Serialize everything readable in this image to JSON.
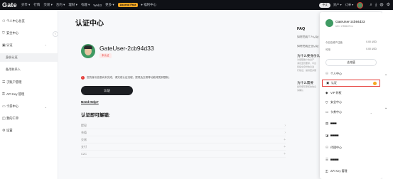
{
  "topbar": {
    "logo": "Gate",
    "nav": [
      "买币 ▾",
      "行情",
      "交易 ▾",
      "合约 ▾",
      "理财 ▾",
      "有趣 ▾",
      "Web3",
      "更多 ▾"
    ],
    "promo": "Ascend Fast",
    "promo_extra": "● 福利中心",
    "lang": "中文",
    "assets": "资产 ▾",
    "orders": "订单 ▾"
  },
  "sidebar": {
    "items": [
      {
        "icon": "person-icon",
        "label": "个人中心总览"
      },
      {
        "icon": "shield-icon",
        "label": "安全中心"
      },
      {
        "icon": "id-icon",
        "label": "认证",
        "expanded": true
      },
      {
        "icon": "",
        "label": "身份认证",
        "sub": true,
        "active": true
      },
      {
        "icon": "",
        "label": "备用联系人",
        "sub": true
      },
      {
        "icon": "list-icon",
        "label": "子账户管理"
      },
      {
        "icon": "key-icon",
        "label": "API Key 管理"
      },
      {
        "icon": "card-icon",
        "label": "卡券中心"
      },
      {
        "icon": "wallet-icon",
        "label": "我的工单"
      },
      {
        "icon": "gear-icon",
        "label": "设置"
      }
    ]
  },
  "main": {
    "title": "认证中心",
    "username": "GateUser-2cb94d33",
    "status_badge": "未认证",
    "warning": "您的身份信息尚未完成，请完成认证流程，提现及交易等功能将受到限制。",
    "verify_button": "认证",
    "need_help": "Need Help?",
    "permissions_title": "认证即可解锁:",
    "permissions": [
      "提现",
      "充值",
      "交易",
      "支付",
      "C2C"
    ]
  },
  "faq": {
    "title": "FAQ",
    "q1": "如何完成个人认证",
    "q2": "如何完成企业认证",
    "h1": "为什么要身份认证",
    "p1": [
      "为保障账户的资产",
      "满足监管要求，平台",
      "您提交身份信息进",
      "行验证，提供更多服"
    ],
    "h2": "为什么需要",
    "p2": [
      "如何填写审核的信息",
      "请确认"
    ]
  },
  "dropdown": {
    "name": "GateUser-2cb94d33",
    "uid": "UID: 17856478 ⧉",
    "line1_label": "今日总资产估值",
    "line1_value": "0.00 USD",
    "line2_label": "可用",
    "line2_value": "0.00 USD",
    "deposit_button": "去充值",
    "items": [
      {
        "icon": "person-icon",
        "label": "个人中心"
      },
      {
        "icon": "id-icon",
        "label": "认证",
        "highlight": true
      },
      {
        "icon": "vip-icon",
        "label": "VIP 特权"
      },
      {
        "icon": "shield-icon",
        "label": "安全中心"
      },
      {
        "icon": "card-icon",
        "label": "卡券中心"
      },
      {
        "icon": "gift-icon",
        "label": "▀▀▀"
      },
      {
        "icon": "share-icon",
        "label": "▀▀▀▀"
      },
      {
        "icon": "users-icon",
        "label": "代理中心"
      },
      {
        "icon": "list-icon",
        "label": "▀▀▀▀"
      },
      {
        "icon": "key-icon",
        "label": "API Key 管理"
      }
    ]
  }
}
